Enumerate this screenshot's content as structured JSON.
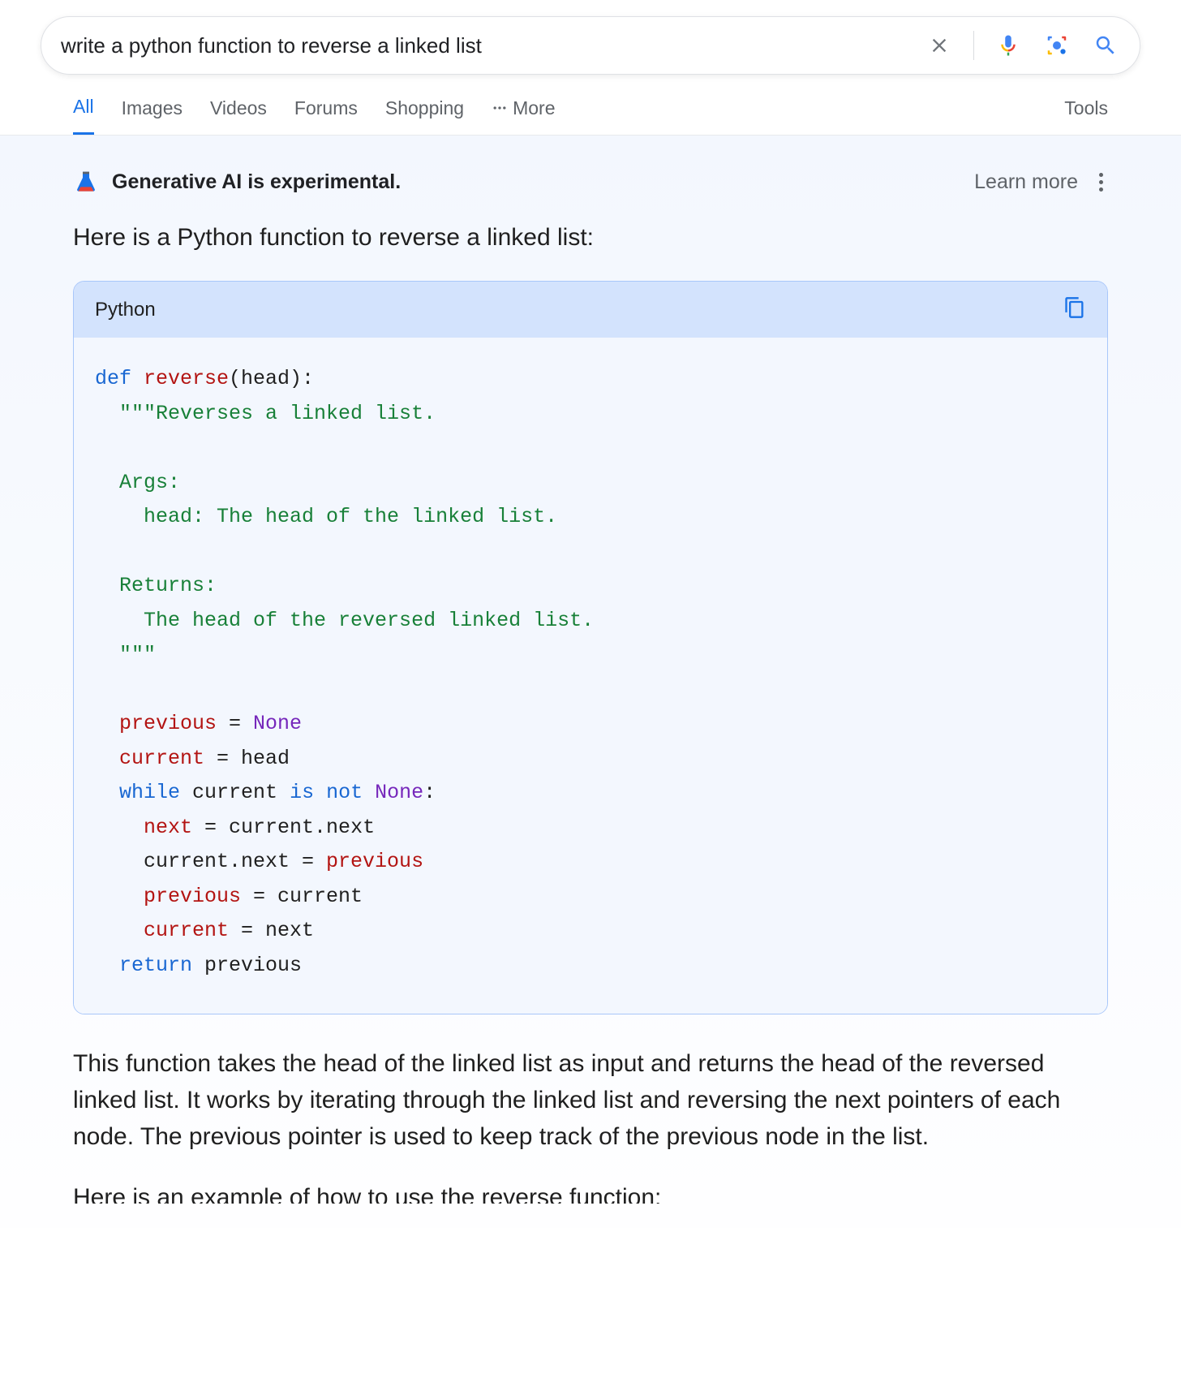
{
  "search": {
    "query": "write a python function to reverse a linked list"
  },
  "tabs": {
    "all": "All",
    "images": "Images",
    "videos": "Videos",
    "forums": "Forums",
    "shopping": "Shopping",
    "more": "More",
    "tools": "Tools"
  },
  "ai": {
    "experimental": "Generative AI is experimental.",
    "learn_more": "Learn more",
    "intro": "Here is a Python function to reverse a linked list:",
    "code_lang": "Python",
    "desc": "This function takes the head of the linked list as input and returns the head of the reversed linked list. It works by iterating through the linked list and reversing the next pointers of each node. The previous pointer is used to keep track of the previous node in the list.",
    "followup": "Here is an example of how to use the reverse function:"
  },
  "code": {
    "l1_def": "def",
    "l1_fn": " reverse",
    "l1_rest": "(head):",
    "l2": "  \"\"\"Reverses a linked list.",
    "l3": "",
    "l4": "  Args:",
    "l5": "    head: The head of the linked list.",
    "l6": "",
    "l7": "  Returns:",
    "l8": "    The head of the reversed linked list.",
    "l9": "  \"\"\"",
    "l10": "",
    "l11_a": "  previous",
    "l11_b": " = ",
    "l11_c": "None",
    "l12_a": "  current",
    "l12_b": " = head",
    "l13_a": "  while",
    "l13_b": " current ",
    "l13_c": "is not",
    "l13_d": " ",
    "l13_e": "None",
    "l13_f": ":",
    "l14_a": "    next",
    "l14_b": " = current.next",
    "l15_a": "    current.next = ",
    "l15_b": "previous",
    "l16_a": "    previous",
    "l16_b": " = current",
    "l17_a": "    current",
    "l17_b": " = next",
    "l18_a": "  return",
    "l18_b": " previous"
  }
}
